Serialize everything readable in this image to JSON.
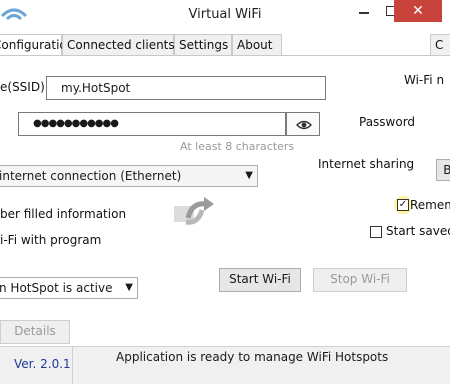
{
  "window": {
    "title": "Virtual WiFi",
    "minimize_glyph": "—",
    "maximize_glyph": "□",
    "close_glyph": "✕"
  },
  "tabs": [
    {
      "label": "Configuration",
      "active": true
    },
    {
      "label": "Connected clients",
      "active": false
    },
    {
      "label": "Settings",
      "active": false
    },
    {
      "label": "About",
      "active": false
    }
  ],
  "right_tab_fragment": "C",
  "config": {
    "ssid_label": "e(SSID)",
    "ssid_value": "my.HotSpot",
    "password_value": "●●●●●●●●●●●",
    "password_hint": "At least 8 characters",
    "wifi_name_label": "Wi-Fi n",
    "password_label": "Password",
    "internet_sharing_label": "Internet sharing",
    "connection_value": "internet connection (Ethernet)",
    "right_button_fragment": "Be",
    "filled_info_label": "ber filled information",
    "remember_label": "Remem",
    "start_with_label": "Start saved",
    "wifi_with_program_label": "i-Fi with program",
    "hotspot_active_label": "n HotSpot is active",
    "details_button": "Details",
    "start_button": "Start Wi-Fi",
    "stop_button": "Stop Wi-Fi"
  },
  "status": {
    "version": "Ver. 2.0.1",
    "message": "Application is ready to manage WiFi Hotspots"
  },
  "icons": {
    "app_logo": "wifi-logo-icon",
    "eye": "eye-icon",
    "refresh": "refresh-icon",
    "dropdown": "chevron-down-icon"
  }
}
